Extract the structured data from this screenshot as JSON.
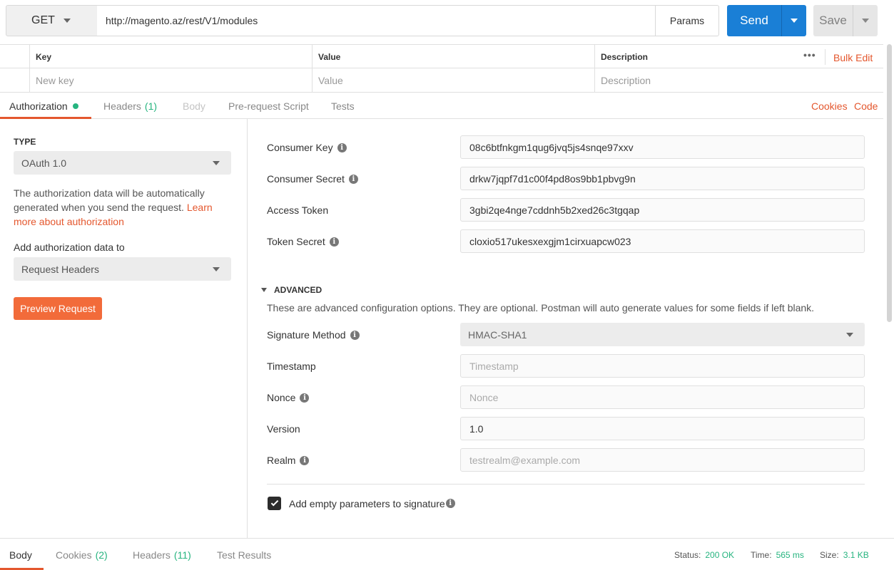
{
  "request": {
    "method": "GET",
    "url": "http://magento.az/rest/V1/modules",
    "params_label": "Params",
    "send_label": "Send",
    "save_label": "Save"
  },
  "params_table": {
    "headers": {
      "key": "Key",
      "value": "Value",
      "description": "Description"
    },
    "placeholders": {
      "key": "New key",
      "value": "Value",
      "description": "Description"
    },
    "bulk_edit": "Bulk Edit",
    "more_icon": "ellipsis-icon"
  },
  "tabs": [
    {
      "label": "Authorization",
      "active": true
    },
    {
      "label": "Headers",
      "count": "(1)"
    },
    {
      "label": "Body",
      "disabled": true
    },
    {
      "label": "Pre-request Script"
    },
    {
      "label": "Tests"
    }
  ],
  "tab_links": {
    "cookies": "Cookies",
    "code": "Code"
  },
  "auth": {
    "type_label": "TYPE",
    "type_value": "OAuth 1.0",
    "info_text": "The authorization data will be automatically generated when you send the request. ",
    "learn_link": "Learn more about authorization",
    "add_to_label": "Add authorization data to",
    "add_to_value": "Request Headers",
    "preview_label": "Preview Request"
  },
  "fields": [
    {
      "label": "Consumer Key",
      "info": true,
      "value": "08c6btfnkgm1qug6jvq5js4snqe97xxv"
    },
    {
      "label": "Consumer Secret",
      "info": true,
      "value": "drkw7jqpf7d1c00f4pd8os9bb1pbvg9n"
    },
    {
      "label": "Access Token",
      "info": false,
      "value": "3gbi2qe4nge7cddnh5b2xed26c3tgqap"
    },
    {
      "label": "Token Secret",
      "info": true,
      "value": "cloxio517ukesxexgjm1cirxuapcw023"
    }
  ],
  "advanced": {
    "heading": "ADVANCED",
    "description": "These are advanced configuration options. They are optional. Postman will auto generate values for some fields if left blank.",
    "signature_label": "Signature Method",
    "signature_value": "HMAC-SHA1",
    "timestamp_label": "Timestamp",
    "timestamp_placeholder": "Timestamp",
    "nonce_label": "Nonce",
    "nonce_placeholder": "Nonce",
    "version_label": "Version",
    "version_value": "1.0",
    "realm_label": "Realm",
    "realm_placeholder": "testrealm@example.com",
    "empty_params_label": "Add empty parameters to signature",
    "empty_params_checked": true
  },
  "response": {
    "tabs": [
      {
        "label": "Body",
        "active": true
      },
      {
        "label": "Cookies",
        "count": "(2)"
      },
      {
        "label": "Headers",
        "count": "(11)"
      },
      {
        "label": "Test Results"
      }
    ],
    "status_label": "Status:",
    "status_value": "200 OK",
    "time_label": "Time:",
    "time_value": "565 ms",
    "size_label": "Size:",
    "size_value": "3.1 KB"
  },
  "colors": {
    "accent": "#e4572e",
    "send_blue": "#1a7fd6",
    "success_green": "#26b47f",
    "preview_orange": "#f26b3a"
  }
}
